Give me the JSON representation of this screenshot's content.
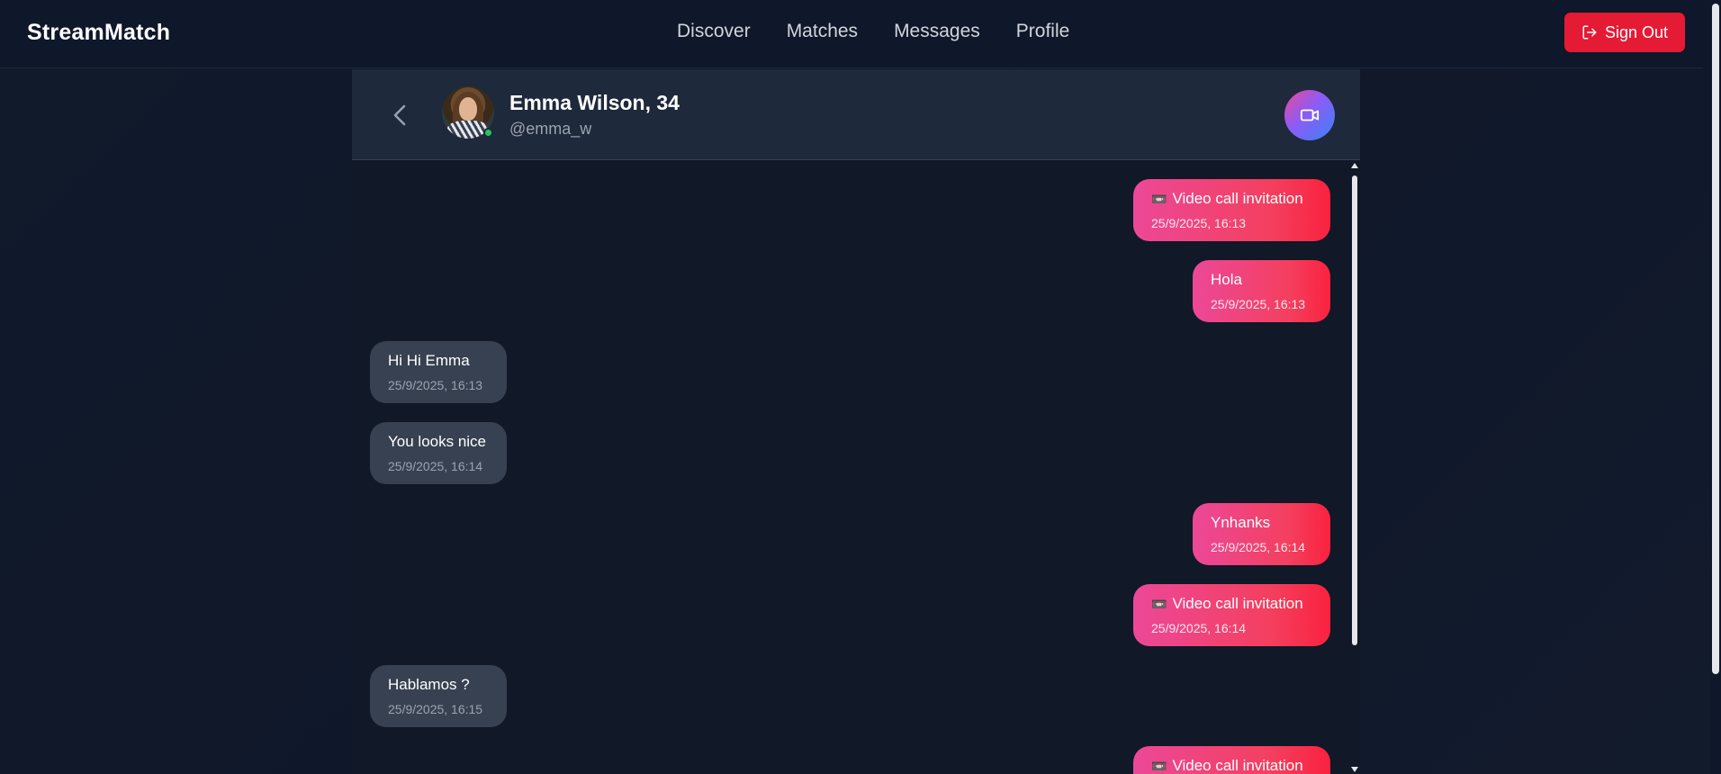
{
  "app": {
    "brand": "StreamMatch"
  },
  "nav": {
    "links": [
      "Discover",
      "Matches",
      "Messages",
      "Profile"
    ],
    "sign_out": "Sign Out"
  },
  "chat": {
    "name": "Emma Wilson, 34",
    "handle": "@emma_w",
    "online": true,
    "messages": [
      {
        "direction": "sent",
        "icon": "video-camera-emoji",
        "icon_glyph": "📼",
        "text": "Video call invitation",
        "time": "25/9/2025, 16:13"
      },
      {
        "direction": "sent",
        "text": "Hola",
        "time": "25/9/2025, 16:13"
      },
      {
        "direction": "received",
        "text": "Hi Hi Emma",
        "time": "25/9/2025, 16:13"
      },
      {
        "direction": "received",
        "text": "You looks nice",
        "time": "25/9/2025, 16:14"
      },
      {
        "direction": "sent",
        "text": "Ynhanks",
        "time": "25/9/2025, 16:14"
      },
      {
        "direction": "sent",
        "icon": "video-camera-emoji",
        "icon_glyph": "📼",
        "text": "Video call invitation",
        "time": "25/9/2025, 16:14"
      },
      {
        "direction": "received",
        "text": "Hablamos ?",
        "time": "25/9/2025, 16:15"
      },
      {
        "direction": "sent",
        "icon": "video-camera-emoji",
        "icon_glyph": "📼",
        "text": "Video call invitation",
        "time": ""
      }
    ]
  },
  "colors": {
    "background": "#0f172a",
    "header": "#1e293b",
    "sent_gradient_start": "#ec4899",
    "sent_gradient_end": "#f9223f",
    "received": "#374151",
    "sign_out": "#e51a35",
    "online": "#22c55e"
  }
}
